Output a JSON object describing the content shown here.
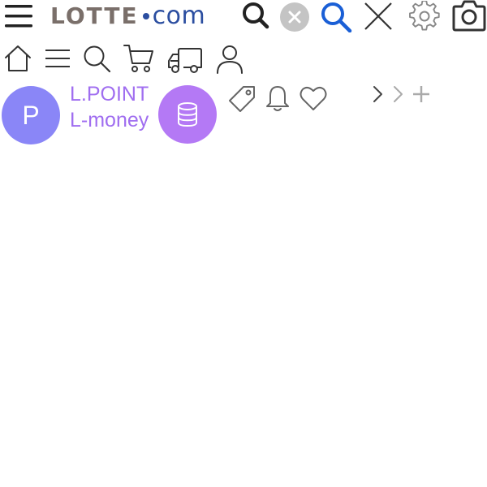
{
  "header": {
    "logo": {
      "brand": "LOTTE",
      "domain": "com",
      "brand_color": "#7a6f6a",
      "dot_color": "#2b4ea0",
      "domain_color": "#2b4ea0"
    },
    "icons": [
      {
        "name": "menu-icon",
        "color": "#222222"
      },
      {
        "name": "search-icon",
        "color": "#222222"
      },
      {
        "name": "clear-circle-icon",
        "color": "#c4c4c4"
      },
      {
        "name": "search-icon",
        "color": "#1a5fd6"
      },
      {
        "name": "close-icon",
        "color": "#333333"
      },
      {
        "name": "gear-icon",
        "color": "#888888"
      },
      {
        "name": "camera-icon",
        "color": "#333333"
      }
    ]
  },
  "toolbar": {
    "icons": [
      "home-icon",
      "menu-icon",
      "search-icon",
      "cart-icon",
      "delivery-truck-icon",
      "user-icon"
    ]
  },
  "points": {
    "avatar_letter": "P",
    "avatar_color": "#8a86f7",
    "lpoint_label": "L.POINT",
    "lmoney_label": "L-money",
    "label_color": "#a06ef0",
    "money_button_color": "#b479f5",
    "icons": [
      "coin-stack-icon",
      "tag-icon",
      "bell-icon",
      "heart-icon",
      "chevron-right-icon",
      "chevron-right-light-icon",
      "plus-icon"
    ]
  }
}
